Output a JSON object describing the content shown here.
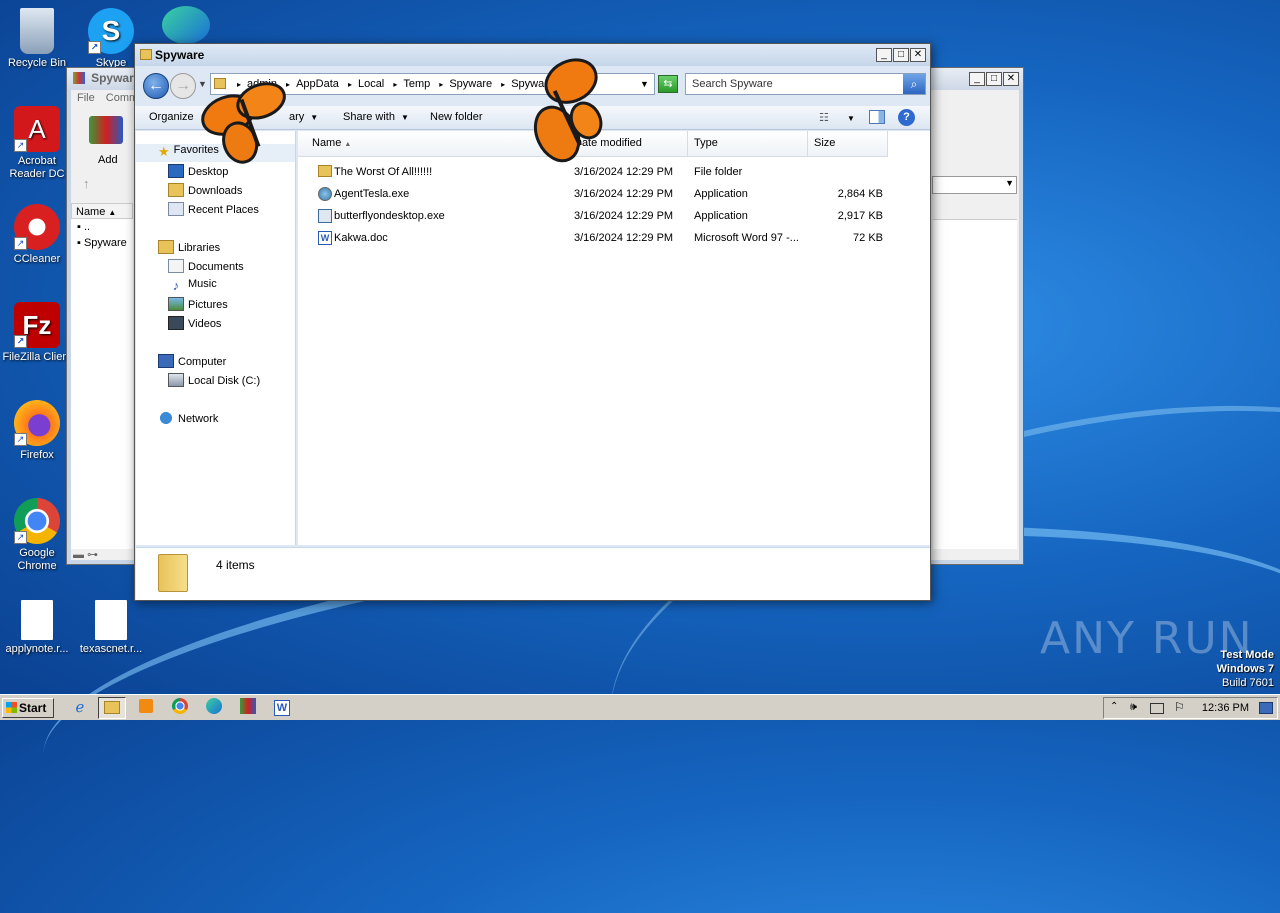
{
  "desktop": {
    "icons": [
      {
        "label": "Recycle Bin",
        "icon": "recycle-bin-icon"
      },
      {
        "label": "Skype",
        "icon": "skype-icon"
      },
      {
        "label": "Acrobat Reader DC",
        "icon": "acrobat-icon"
      },
      {
        "label": "CCleaner",
        "icon": "ccleaner-icon"
      },
      {
        "label": "FileZilla Client",
        "icon": "filezilla-icon"
      },
      {
        "label": "Firefox",
        "icon": "firefox-icon"
      },
      {
        "label": "Google Chrome",
        "icon": "chrome-icon"
      },
      {
        "label": "applynote.r...",
        "icon": "document-icon"
      },
      {
        "label": "texascnet.r...",
        "icon": "document-icon"
      }
    ],
    "watermark": "ANY RUN",
    "test_mode": {
      "line1": "Test Mode",
      "line2": "Windows 7",
      "line3": "Build 7601"
    }
  },
  "back_window": {
    "title": "Spyware",
    "menu": [
      "File",
      "Comm"
    ],
    "add_label": "Add",
    "column_name": "Name",
    "rows": [
      "..",
      "Spyware"
    ]
  },
  "explorer": {
    "title": "Spyware",
    "breadcrumb": [
      "admin",
      "AppData",
      "Local",
      "Temp",
      "Spyware",
      "Spyware"
    ],
    "search_placeholder": "Search Spyware",
    "toolbar": {
      "organize": "Organize",
      "library": "ary",
      "share_with": "Share with",
      "new_folder": "New folder"
    },
    "nav": {
      "favorites": "Favorites",
      "desktop": "Desktop",
      "downloads": "Downloads",
      "recent_places": "Recent Places",
      "libraries": "Libraries",
      "documents": "Documents",
      "music": "Music",
      "pictures": "Pictures",
      "videos": "Videos",
      "computer": "Computer",
      "local_disk": "Local Disk (C:)",
      "network": "Network"
    },
    "columns": {
      "name": "Name",
      "date": "Date modified",
      "type": "Type",
      "size": "Size"
    },
    "files": [
      {
        "name": "The Worst Of All!!!!!!",
        "date": "3/16/2024 12:29 PM",
        "type": "File folder",
        "size": "",
        "icon": "folder-icon"
      },
      {
        "name": "AgentTesla.exe",
        "date": "3/16/2024 12:29 PM",
        "type": "Application",
        "size": "2,864 KB",
        "icon": "exe-icon"
      },
      {
        "name": "butterflyondesktop.exe",
        "date": "3/16/2024 12:29 PM",
        "type": "Application",
        "size": "2,917 KB",
        "icon": "exe-icon"
      },
      {
        "name": "Kakwa.doc",
        "date": "3/16/2024 12:29 PM",
        "type": "Microsoft Word 97 -...",
        "size": "72 KB",
        "icon": "word-doc-icon"
      }
    ],
    "status": "4 items"
  },
  "taskbar": {
    "start": "Start",
    "clock": "12:36 PM"
  }
}
